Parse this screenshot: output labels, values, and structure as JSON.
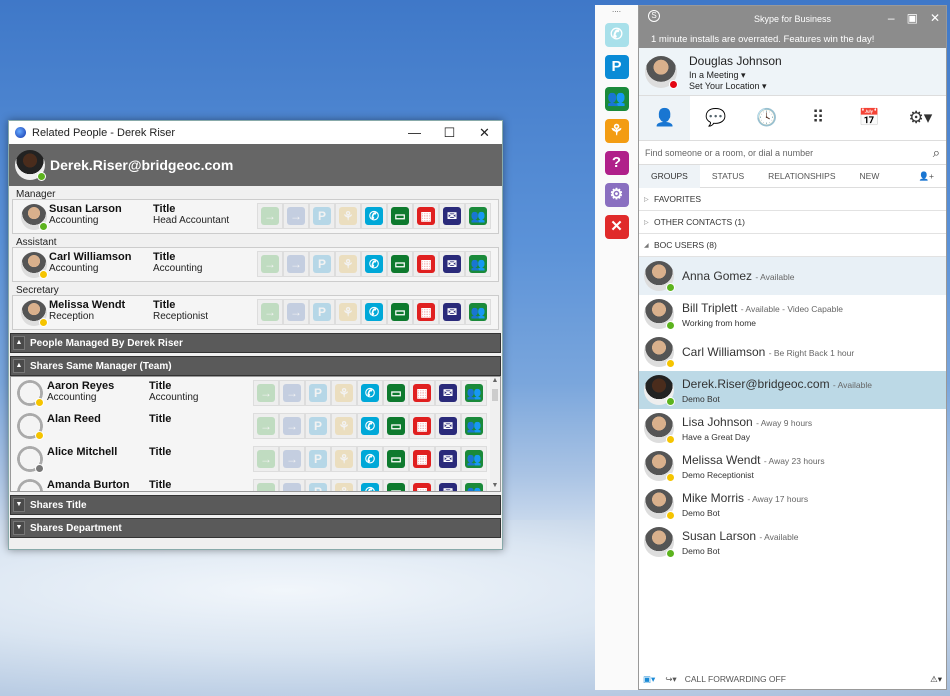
{
  "related": {
    "window_title": "Related People - Derek Riser",
    "user": "Derek.Riser@bridgeoc.com",
    "sections": [
      {
        "label": "Manager",
        "name": "Susan Larson",
        "dept": "Accounting",
        "title_label": "Title",
        "title": "Head Accountant",
        "status": "green"
      },
      {
        "label": "Assistant",
        "name": "Carl Williamson",
        "dept": "Accounting",
        "title_label": "Title",
        "title": "Accounting",
        "status": "yellow"
      },
      {
        "label": "Secretary",
        "name": "Melissa Wendt",
        "dept": "Reception",
        "title_label": "Title",
        "title": "Receptionist",
        "status": "yellow"
      }
    ],
    "groups": {
      "managed": "People Managed By Derek Riser",
      "team": "Shares Same Manager (Team)",
      "title": "Shares Title",
      "dept": "Shares Department"
    },
    "team": [
      {
        "name": "Aaron Reyes",
        "dept": "Accounting",
        "title_label": "Title",
        "title": "Accounting",
        "status": "yellow"
      },
      {
        "name": "Alan Reed",
        "dept": "",
        "title_label": "Title",
        "title": "",
        "status": "yellow"
      },
      {
        "name": "Alice Mitchell",
        "dept": "",
        "title_label": "Title",
        "title": "",
        "status": "gray"
      },
      {
        "name": "Amanda Burton",
        "dept": "",
        "title_label": "Title",
        "title": "",
        "status": "yellow"
      }
    ],
    "actions": [
      {
        "icon": "transfer-icon",
        "color": "#4caf50",
        "glyph": "→",
        "enabled": false
      },
      {
        "icon": "forward-icon",
        "color": "#5b7fbf",
        "glyph": "→",
        "enabled": false
      },
      {
        "icon": "park-icon",
        "color": "#2a9fd8",
        "glyph": "P",
        "enabled": false
      },
      {
        "icon": "org-icon",
        "color": "#e6b84a",
        "glyph": "⚘",
        "enabled": false
      },
      {
        "icon": "phone-icon",
        "color": "#00a8d8",
        "glyph": "✆",
        "enabled": true
      },
      {
        "icon": "chat-icon",
        "color": "#0e7a2e",
        "glyph": "▭",
        "enabled": true
      },
      {
        "icon": "calendar-icon",
        "color": "#e02020",
        "glyph": "▦",
        "enabled": true
      },
      {
        "icon": "mail-icon",
        "color": "#2a2a7a",
        "glyph": "✉",
        "enabled": true
      },
      {
        "icon": "contacts-icon",
        "color": "#1a8a3a",
        "glyph": "👥",
        "enabled": true
      }
    ]
  },
  "strip": {
    "dots": "....",
    "icons": [
      {
        "icon": "phone-icon",
        "color": "#a8e0ea",
        "glyph": "✆"
      },
      {
        "icon": "park-icon",
        "color": "#0a8bd6",
        "glyph": "P"
      },
      {
        "icon": "contacts-icon",
        "color": "#1a8a3a",
        "glyph": "👥"
      },
      {
        "icon": "org-chart-icon",
        "color": "#f39c12",
        "glyph": "⚘"
      },
      {
        "icon": "help-icon",
        "color": "#b0208a",
        "glyph": "?"
      },
      {
        "icon": "settings-icon",
        "color": "#8a6fc0",
        "glyph": "⚙"
      },
      {
        "icon": "close-icon",
        "color": "#e02a2a",
        "glyph": "✕"
      }
    ]
  },
  "skype": {
    "title": "Skype for Business",
    "message": "1 minute installs are overrated.  Features win the day!",
    "user": {
      "name": "Douglas Johnson",
      "status": "In a Meeting ▾",
      "location": "Set Your Location ▾"
    },
    "search_placeholder": "Find someone or a room, or dial a number",
    "tabs": [
      "GROUPS",
      "STATUS",
      "RELATIONSHIPS",
      "NEW"
    ],
    "groups": [
      "FAVORITES",
      "OTHER CONTACTS (1)",
      "BOC USERS (8)"
    ],
    "contacts": [
      {
        "name": "Anna Gomez",
        "status": "- Available",
        "note": "",
        "presence": "green"
      },
      {
        "name": "Bill Triplett",
        "status": "- Available - Video Capable",
        "note": "Working from home",
        "presence": "green"
      },
      {
        "name": "Carl Williamson",
        "status": "- Be Right Back 1 hour",
        "note": "",
        "presence": "yellow"
      },
      {
        "name": "Derek.Riser@bridgeoc.com",
        "status": "- Available",
        "note": "Demo Bot",
        "presence": "green"
      },
      {
        "name": "Lisa Johnson",
        "status": "- Away 9 hours",
        "note": "Have a Great Day",
        "presence": "yellow"
      },
      {
        "name": "Melissa Wendt",
        "status": "- Away 23 hours",
        "note": "Demo Receptionist",
        "presence": "yellow"
      },
      {
        "name": "Mike Morris",
        "status": "- Away 17 hours",
        "note": "Demo Bot",
        "presence": "yellow"
      },
      {
        "name": "Susan Larson",
        "status": "- Available",
        "note": "Demo Bot",
        "presence": "green"
      }
    ],
    "footer": "CALL FORWARDING OFF"
  }
}
